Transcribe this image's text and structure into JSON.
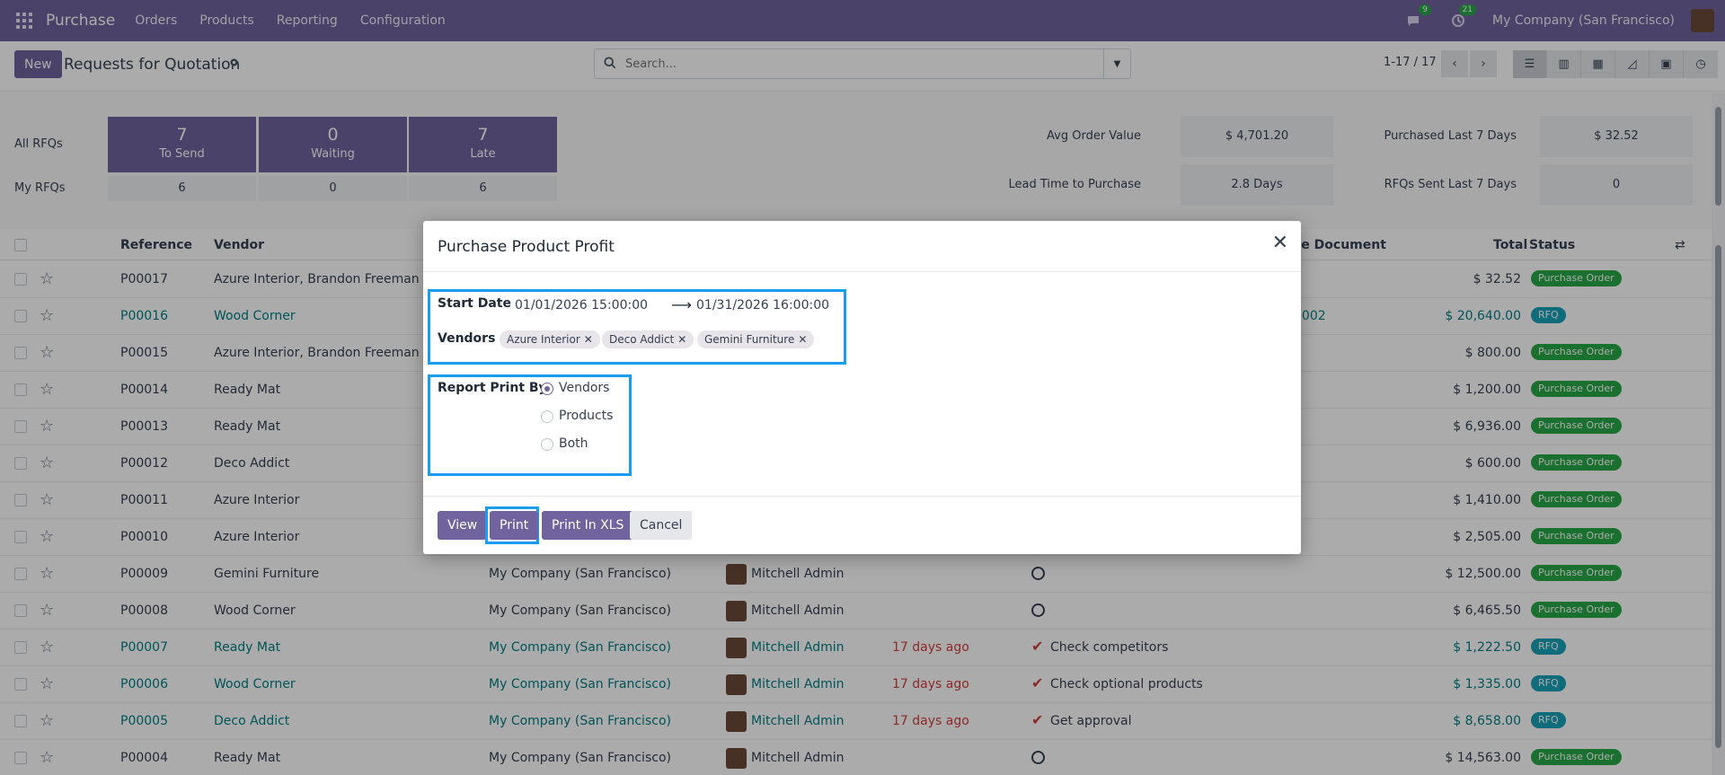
{
  "navbar": {
    "app_name": "Purchase",
    "menu": [
      "Orders",
      "Products",
      "Reporting",
      "Configuration"
    ],
    "messages_badge": "9",
    "activities_badge": "21",
    "company": "My Company (San Francisco)"
  },
  "control": {
    "new_label": "New",
    "title": "Requests for Quotation",
    "search_placeholder": "Search...",
    "pager": "1-17 / 17"
  },
  "dashboard": {
    "all_rfqs": "All RFQs",
    "my_rfqs": "My RFQs",
    "tiles": [
      {
        "num": "7",
        "label": "To Send",
        "mine": "6"
      },
      {
        "num": "0",
        "label": "Waiting",
        "mine": "0"
      },
      {
        "num": "7",
        "label": "Late",
        "mine": "6"
      }
    ],
    "kpis": {
      "avg_order_label": "Avg Order Value",
      "avg_order_value": "$ 4,701.20",
      "purchased_label": "Purchased Last 7 Days",
      "purchased_value": "$ 32.52",
      "lead_time_label": "Lead Time to Purchase",
      "lead_time_value": "2.8 Days",
      "rfq_sent_label": "RFQs Sent Last 7 Days",
      "rfq_sent_value": "0"
    }
  },
  "table": {
    "headers": {
      "reference": "Reference",
      "vendor": "Vendor",
      "source": "ce Document",
      "total": "Total",
      "status": "Status"
    },
    "rows": [
      {
        "ref": "P00017",
        "vendor": "Azure Interior, Brandon Freeman",
        "company": "",
        "buyer": "",
        "deadline": "",
        "activity": "",
        "source": "",
        "total": "$ 32.52",
        "status": "Purchase Order"
      },
      {
        "ref": "P00016",
        "vendor": "Wood Corner",
        "company": "",
        "buyer": "",
        "deadline": "",
        "activity": "",
        "source": "0002",
        "total": "$ 20,640.00",
        "status": "RFQ"
      },
      {
        "ref": "P00015",
        "vendor": "Azure Interior, Brandon Freeman",
        "company": "",
        "buyer": "",
        "deadline": "",
        "activity": "",
        "source": "",
        "total": "$ 800.00",
        "status": "Purchase Order"
      },
      {
        "ref": "P00014",
        "vendor": "Ready Mat",
        "company": "",
        "buyer": "",
        "deadline": "",
        "activity": "",
        "source": "",
        "total": "$ 1,200.00",
        "status": "Purchase Order"
      },
      {
        "ref": "P00013",
        "vendor": "Ready Mat",
        "company": "",
        "buyer": "",
        "deadline": "",
        "activity": "",
        "source": "",
        "total": "$ 6,936.00",
        "status": "Purchase Order"
      },
      {
        "ref": "P00012",
        "vendor": "Deco Addict",
        "company": "",
        "buyer": "",
        "deadline": "",
        "activity": "",
        "source": "",
        "total": "$ 600.00",
        "status": "Purchase Order"
      },
      {
        "ref": "P00011",
        "vendor": "Azure Interior",
        "company": "",
        "buyer": "",
        "deadline": "",
        "activity": "",
        "source": "",
        "total": "$ 1,410.00",
        "status": "Purchase Order"
      },
      {
        "ref": "P00010",
        "vendor": "Azure Interior",
        "company": "",
        "buyer": "",
        "deadline": "",
        "activity": "",
        "source": "",
        "total": "$ 2,505.00",
        "status": "Purchase Order"
      },
      {
        "ref": "P00009",
        "vendor": "Gemini Furniture",
        "company": "My Company (San Francisco)",
        "buyer": "Mitchell Admin",
        "deadline": "",
        "activity": "",
        "source": "",
        "total": "$ 12,500.00",
        "status": "Purchase Order"
      },
      {
        "ref": "P00008",
        "vendor": "Wood Corner",
        "company": "My Company (San Francisco)",
        "buyer": "Mitchell Admin",
        "deadline": "",
        "activity": "",
        "source": "",
        "total": "$ 6,465.50",
        "status": "Purchase Order"
      },
      {
        "ref": "P00007",
        "vendor": "Ready Mat",
        "company": "My Company (San Francisco)",
        "buyer": "Mitchell Admin",
        "deadline": "17 days ago",
        "activity": "Check competitors",
        "source": "",
        "total": "$ 1,222.50",
        "status": "RFQ"
      },
      {
        "ref": "P00006",
        "vendor": "Wood Corner",
        "company": "My Company (San Francisco)",
        "buyer": "Mitchell Admin",
        "deadline": "17 days ago",
        "activity": "Check optional products",
        "source": "",
        "total": "$ 1,335.00",
        "status": "RFQ"
      },
      {
        "ref": "P00005",
        "vendor": "Deco Addict",
        "company": "My Company (San Francisco)",
        "buyer": "Mitchell Admin",
        "deadline": "17 days ago",
        "activity": "Get approval",
        "source": "",
        "total": "$ 8,658.00",
        "status": "RFQ"
      },
      {
        "ref": "P00004",
        "vendor": "Ready Mat",
        "company": "My Company (San Francisco)",
        "buyer": "Mitchell Admin",
        "deadline": "",
        "activity": "",
        "source": "",
        "total": "$ 14,563.00",
        "status": "Purchase Order"
      }
    ]
  },
  "modal": {
    "title": "Purchase Product Profit",
    "start_date_label": "Start Date",
    "start_date": "01/01/2026 15:00:00",
    "end_date": "01/31/2026 16:00:00",
    "vendors_label": "Vendors",
    "vendors": [
      "Azure Interior",
      "Deco Addict",
      "Gemini Furniture"
    ],
    "report_label": "Report Print By",
    "report_options": [
      "Vendors",
      "Products",
      "Both"
    ],
    "report_selected": "Vendors",
    "buttons": {
      "view": "View",
      "print": "Print",
      "print_xls": "Print In XLS",
      "cancel": "Cancel"
    }
  },
  "colors": {
    "brand": "#71639e",
    "highlight": "#1a9cf0",
    "po_badge": "#28a745",
    "rfq_badge": "#17a2b8"
  }
}
